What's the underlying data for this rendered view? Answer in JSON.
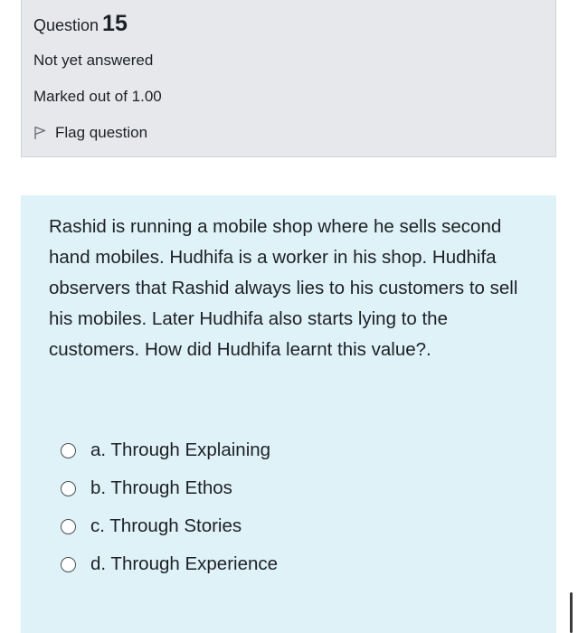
{
  "question": {
    "label": "Question",
    "number": "15",
    "state": "Not yet answered",
    "grade": "Marked out of 1.00",
    "flag_label": "Flag question",
    "text": "Rashid is running a mobile shop where he sells second hand mobiles. Hudhifa is a worker in his shop. Hudhifa observers that Rashid always lies to his customers to sell his mobiles. Later Hudhifa also starts lying to the customers. How did Hudhifa learnt this value?.",
    "answers": [
      {
        "label": "a. Through Explaining"
      },
      {
        "label": "b. Through Ethos"
      },
      {
        "label": "c. Through Stories"
      },
      {
        "label": "d. Through Experience"
      }
    ]
  },
  "colors": {
    "info_bg": "#e7e8eb",
    "content_bg": "#dff2f8",
    "text": "#1d2125"
  },
  "icons": {
    "flag": "flag-icon",
    "radio": "radio-unselected-icon"
  }
}
